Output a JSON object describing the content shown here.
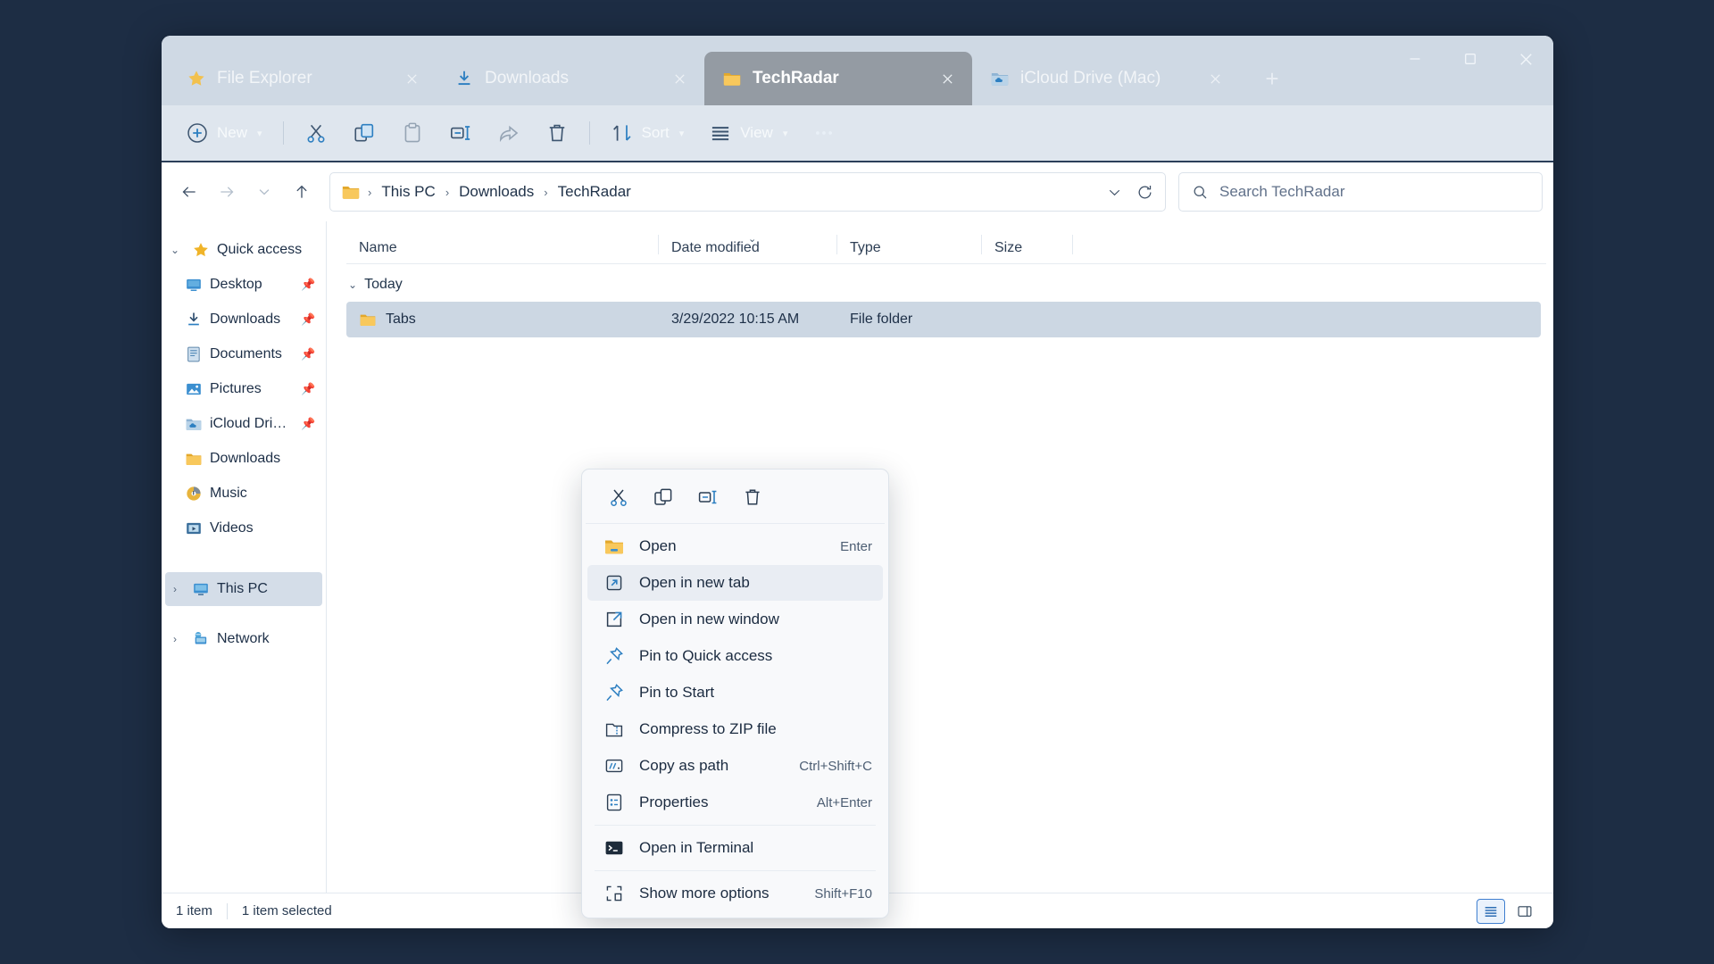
{
  "window": {
    "caption": {
      "minimize": "minimize-button",
      "maximize": "maximize-button",
      "close": "close-button"
    }
  },
  "tabs": [
    {
      "label": "File Explorer",
      "icon": "star-icon",
      "active": false
    },
    {
      "label": "Downloads",
      "icon": "download-icon",
      "active": false
    },
    {
      "label": "TechRadar",
      "icon": "folder-icon",
      "active": true
    },
    {
      "label": "iCloud Drive (Mac)",
      "icon": "icloud-folder-icon",
      "active": false
    }
  ],
  "tabbar": {
    "new_tab": "+"
  },
  "toolbar": {
    "new_label": "New",
    "sort_label": "Sort",
    "view_label": "View",
    "more_label": "…",
    "cut_label": "Cut",
    "copy_label": "Copy",
    "paste_label": "Paste",
    "rename_label": "Rename",
    "share_label": "Share",
    "delete_label": "Delete"
  },
  "address": {
    "back": "back-button",
    "forward": "forward-button",
    "recent": "recent-locations-button",
    "up": "up-button",
    "crumbs": [
      "This PC",
      "Downloads",
      "TechRadar"
    ],
    "separator": "›",
    "dropdown": "previous-locations",
    "refresh": "refresh-button"
  },
  "search": {
    "placeholder": "Search TechRadar",
    "value": ""
  },
  "sidebar": {
    "items": [
      {
        "label": "Quick access",
        "icon": "star-icon",
        "twisty": "expanded",
        "pinned": false,
        "indent": false,
        "selected": false
      },
      {
        "label": "Desktop",
        "icon": "desktop-icon",
        "twisty": "",
        "pinned": true,
        "indent": true,
        "selected": false
      },
      {
        "label": "Downloads",
        "icon": "download-icon",
        "twisty": "",
        "pinned": true,
        "indent": true,
        "selected": false
      },
      {
        "label": "Documents",
        "icon": "documents-icon",
        "twisty": "",
        "pinned": true,
        "indent": true,
        "selected": false
      },
      {
        "label": "Pictures",
        "icon": "pictures-icon",
        "twisty": "",
        "pinned": true,
        "indent": true,
        "selected": false
      },
      {
        "label": "iCloud Drive (M",
        "icon": "icloud-folder-icon",
        "twisty": "",
        "pinned": true,
        "indent": true,
        "selected": false
      },
      {
        "label": "Downloads",
        "icon": "folder-icon",
        "twisty": "",
        "pinned": false,
        "indent": true,
        "selected": false
      },
      {
        "label": "Music",
        "icon": "music-icon",
        "twisty": "",
        "pinned": false,
        "indent": true,
        "selected": false
      },
      {
        "label": "Videos",
        "icon": "videos-icon",
        "twisty": "",
        "pinned": false,
        "indent": true,
        "selected": false
      },
      {
        "label": "This PC",
        "icon": "this-pc-icon",
        "twisty": "collapsed",
        "pinned": false,
        "indent": false,
        "selected": true
      },
      {
        "label": "Network",
        "icon": "network-icon",
        "twisty": "collapsed",
        "pinned": false,
        "indent": false,
        "selected": false
      }
    ]
  },
  "filelist": {
    "columns": [
      {
        "label": "Name",
        "sorted": false
      },
      {
        "label": "Date modified",
        "sorted": true
      },
      {
        "label": "Type",
        "sorted": false
      },
      {
        "label": "Size",
        "sorted": false
      }
    ],
    "groups": [
      {
        "label": "Today",
        "rows": [
          {
            "name": "Tabs",
            "date": "3/29/2022 10:15 AM",
            "type": "File folder",
            "size": "",
            "icon": "folder-icon",
            "selected": true
          }
        ]
      }
    ]
  },
  "status": {
    "item_count": "1 item",
    "selection": "1 item selected",
    "details_view": "details-view-toggle",
    "preview_pane": "preview-pane-toggle"
  },
  "contextmenu": {
    "quick_actions": [
      {
        "name": "cut-icon",
        "label": "Cut"
      },
      {
        "name": "copy-icon",
        "label": "Copy"
      },
      {
        "name": "rename-icon",
        "label": "Rename"
      },
      {
        "name": "delete-icon",
        "label": "Delete"
      }
    ],
    "items": [
      {
        "label": "Open",
        "shortcut": "Enter",
        "icon": "folder-icon",
        "highlighted": false,
        "separator_after": false
      },
      {
        "label": "Open in new tab",
        "shortcut": "",
        "icon": "open-new-tab-icon",
        "highlighted": true,
        "separator_after": false
      },
      {
        "label": "Open in new window",
        "shortcut": "",
        "icon": "open-new-window-icon",
        "highlighted": false,
        "separator_after": false
      },
      {
        "label": "Pin to Quick access",
        "shortcut": "",
        "icon": "pin-icon",
        "highlighted": false,
        "separator_after": false
      },
      {
        "label": "Pin to Start",
        "shortcut": "",
        "icon": "pin-icon",
        "highlighted": false,
        "separator_after": false
      },
      {
        "label": "Compress to ZIP file",
        "shortcut": "",
        "icon": "zip-icon",
        "highlighted": false,
        "separator_after": false
      },
      {
        "label": "Copy as path",
        "shortcut": "Ctrl+Shift+C",
        "icon": "copy-path-icon",
        "highlighted": false,
        "separator_after": false
      },
      {
        "label": "Properties",
        "shortcut": "Alt+Enter",
        "icon": "properties-icon",
        "highlighted": false,
        "separator_after": true
      },
      {
        "label": "Open in Terminal",
        "shortcut": "",
        "icon": "terminal-icon",
        "highlighted": false,
        "separator_after": true
      },
      {
        "label": "Show more options",
        "shortcut": "Shift+F10",
        "icon": "more-options-icon",
        "highlighted": false,
        "separator_after": false
      }
    ]
  },
  "colors": {
    "desktop": "#1d2d44",
    "tabstrip": "#cfd9e4",
    "active_tab": "#949ba3",
    "commandbar": "#dfe6ee",
    "accent": "#3f7fd0",
    "selection": "#ccd7e3",
    "folder_yellow": "#f0b429"
  }
}
